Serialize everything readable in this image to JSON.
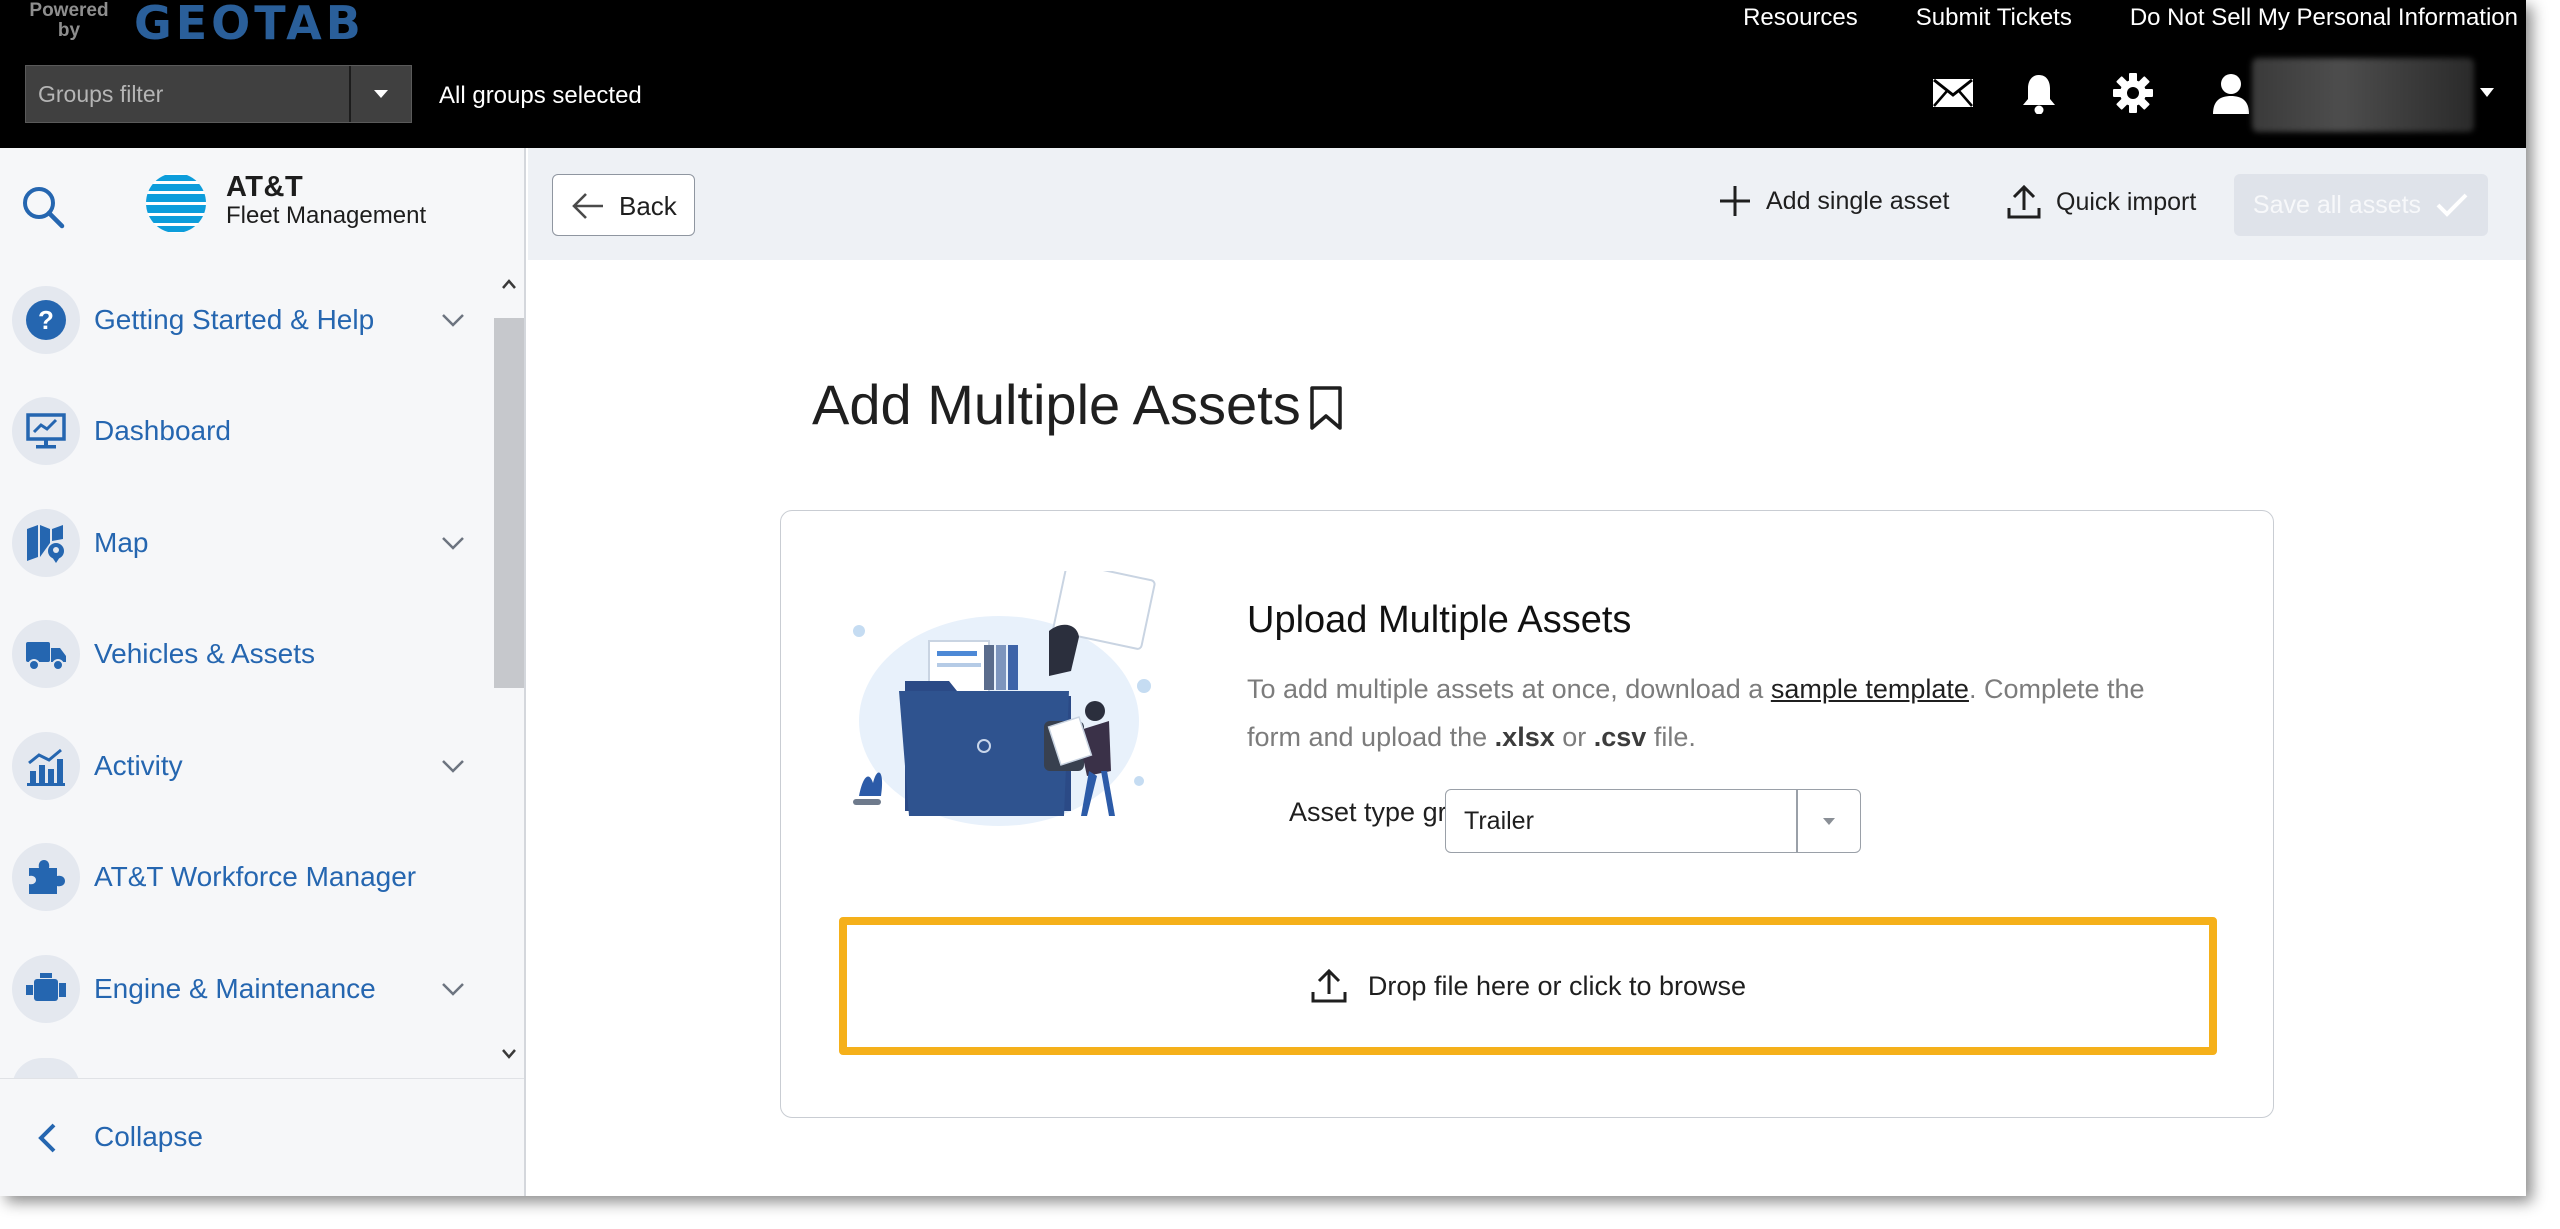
{
  "topbar": {
    "powered_by": "Powered by",
    "brand": "GEOTAB",
    "links": [
      "Resources",
      "Submit Tickets",
      "Do Not Sell My Personal Information"
    ],
    "groups_filter": {
      "placeholder": "Groups filter",
      "value": ""
    },
    "groups_status": "All groups selected",
    "icons": [
      "mail-icon",
      "bell-icon",
      "gear-icon",
      "user-icon"
    ]
  },
  "sidebar": {
    "logo": {
      "line1": "AT&T",
      "line2": "Fleet Management"
    },
    "items": [
      {
        "label": "Getting Started & Help",
        "icon": "help-icon",
        "expandable": true
      },
      {
        "label": "Dashboard",
        "icon": "dashboard-icon",
        "expandable": false
      },
      {
        "label": "Map",
        "icon": "map-icon",
        "expandable": true
      },
      {
        "label": "Vehicles & Assets",
        "icon": "truck-icon",
        "expandable": false
      },
      {
        "label": "Activity",
        "icon": "activity-icon",
        "expandable": true
      },
      {
        "label": "AT&T Workforce Manager",
        "icon": "puzzle-icon",
        "expandable": false
      },
      {
        "label": "Engine & Maintenance",
        "icon": "engine-icon",
        "expandable": true
      }
    ],
    "collapse_label": "Collapse"
  },
  "toolbar": {
    "back_label": "Back",
    "add_single_label": "Add single asset",
    "quick_import_label": "Quick import",
    "save_label": "Save all assets"
  },
  "page": {
    "title": "Add Multiple Assets",
    "card": {
      "title": "Upload Multiple Assets",
      "desc_before": "To add multiple assets at once, download a ",
      "desc_link": "sample template",
      "desc_after": ". Complete the form and upload the ",
      "ext_xlsx": ".xlsx",
      "desc_or": " or ",
      "ext_csv": ".csv",
      "desc_end": " file.",
      "asset_type_label": "Asset type group:",
      "asset_type_value": "Trailer",
      "dropzone_label": "Drop file here or click to browse"
    }
  },
  "colors": {
    "topbar_bg": "#000000",
    "brand_blue": "#2a5f9a",
    "nav_link": "#2566b0",
    "dropzone_border": "#f5b01a",
    "toolbar_bg": "#eef1f5",
    "sidebar_bg": "#f6f7f9"
  }
}
